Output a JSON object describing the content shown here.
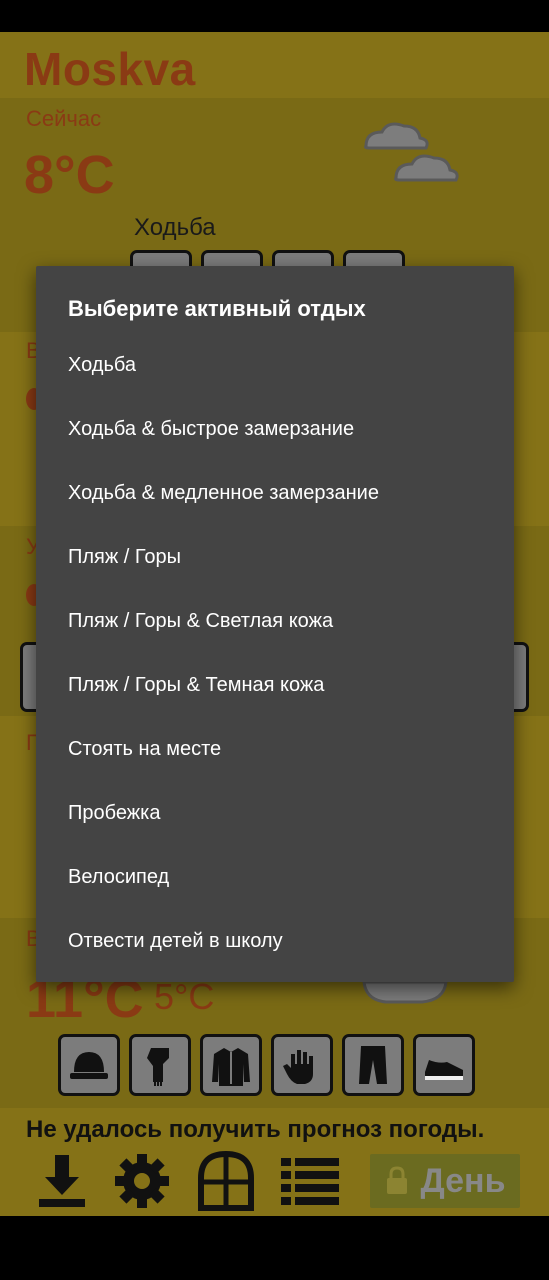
{
  "app": {
    "city": "Moskva",
    "now_label": "Сейчас",
    "now_temp": "8°C",
    "activity_label": "Ходьба",
    "bottom_temp": "11°C",
    "bottom_min_temp": "5°C",
    "error_message": "Не удалось получить прогноз погоды.",
    "day_button": "День",
    "partial_labels": [
      "В",
      "У",
      "П",
      "В"
    ]
  },
  "clothing_icons": [
    "hat-icon",
    "scarf-icon",
    "jacket-icon",
    "glove-icon",
    "pants-icon",
    "shoe-icon"
  ],
  "toolbar_icons": [
    "download-icon",
    "gear-icon",
    "window-icon",
    "list-icon",
    "lock-icon"
  ],
  "dialog": {
    "title": "Выберите активный отдых",
    "options": [
      "Ходьба",
      "Ходьба & быстрое замерзание",
      "Ходьба & медленное замерзание",
      "Пляж / Горы",
      "Пляж / Горы & Светлая кожа",
      "Пляж / Горы & Темная кожа",
      "Стоять на месте",
      "Пробежка",
      "Велосипед",
      "Отвести детей в школу"
    ]
  },
  "colors": {
    "background": "#857217",
    "accent_text": "#8a3a14",
    "dialog_bg": "#444444"
  }
}
